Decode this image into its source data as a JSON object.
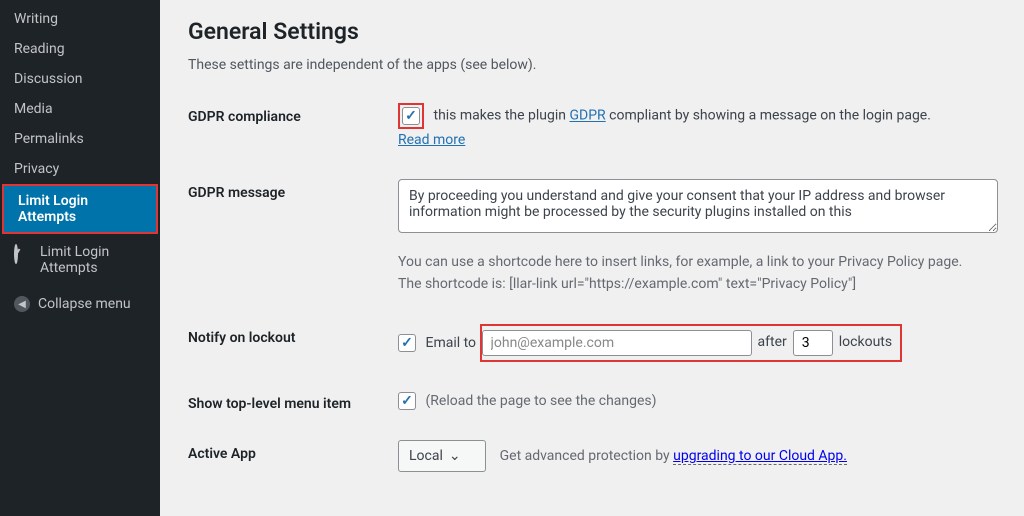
{
  "sidebar": {
    "items": [
      {
        "label": "Writing"
      },
      {
        "label": "Reading"
      },
      {
        "label": "Discussion"
      },
      {
        "label": "Media"
      },
      {
        "label": "Permalinks"
      },
      {
        "label": "Privacy"
      },
      {
        "label": "Limit Login Attempts"
      }
    ],
    "section": {
      "label": "Limit Login Attempts"
    },
    "collapse": "Collapse menu"
  },
  "page": {
    "title": "General Settings",
    "subhead": "These settings are independent of the apps (see below)."
  },
  "gdpr": {
    "label": "GDPR compliance",
    "pre": "this makes the plugin ",
    "link1": "GDPR",
    "post": " compliant by showing a message on the login page. ",
    "readmore": "Read more"
  },
  "gdpr_msg": {
    "label": "GDPR message",
    "value": "By proceeding you understand and give your consent that your IP address and browser information might be processed by the security plugins installed on this",
    "help1": "You can use a shortcode here to insert links, for example, a link to your Privacy Policy page.",
    "help2": "The shortcode is: [llar-link url=\"https://example.com\" text=\"Privacy Policy\"]"
  },
  "notify": {
    "label": "Notify on lockout",
    "emailto": "Email to",
    "email_value": "john@example.com",
    "after": "after",
    "count": "3",
    "lockouts": "lockouts"
  },
  "toplevel": {
    "label": "Show top-level menu item",
    "hint": "(Reload the page to see the changes)"
  },
  "active": {
    "label": "Active App",
    "selected": "Local",
    "upg_pre": "Get advanced protection by ",
    "upg_link": "upgrading to our Cloud App."
  }
}
